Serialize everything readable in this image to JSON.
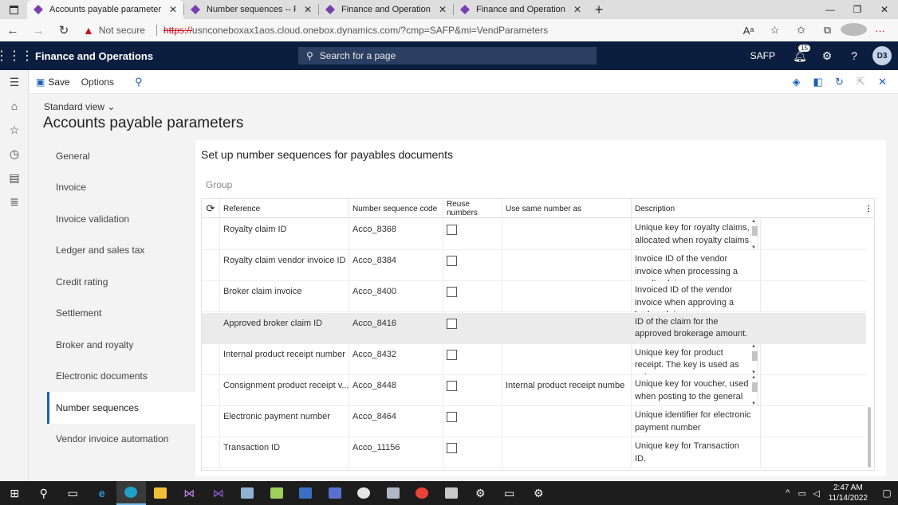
{
  "browser": {
    "tabs": [
      {
        "label": "Accounts payable parameters --",
        "active": true
      },
      {
        "label": "Number sequences -- Finance ar",
        "active": false
      },
      {
        "label": "Finance and Operations",
        "active": false
      },
      {
        "label": "Finance and Operations",
        "active": false
      }
    ],
    "security_label": "Not secure",
    "url_scheme": "https://",
    "url_rest": "usnconeboxax1aos.cloud.onebox.dynamics.com/?cmp=SAFP&mi=VendParameters"
  },
  "app": {
    "title": "Finance and Operations",
    "search_placeholder": "Search for a page",
    "company": "SAFP",
    "notification_count": "15",
    "avatar_initials": "D3"
  },
  "actionpane": {
    "save_label": "Save",
    "options_label": "Options"
  },
  "page": {
    "view_label": "Standard view",
    "title": "Accounts payable parameters",
    "section_title": "Set up number sequences for payables documents",
    "group_label": "Group"
  },
  "vtabs": [
    {
      "label": "General",
      "active": false
    },
    {
      "label": "Invoice",
      "active": false
    },
    {
      "label": "Invoice validation",
      "active": false
    },
    {
      "label": "Ledger and sales tax",
      "active": false
    },
    {
      "label": "Credit rating",
      "active": false
    },
    {
      "label": "Settlement",
      "active": false
    },
    {
      "label": "Broker and royalty",
      "active": false
    },
    {
      "label": "Electronic documents",
      "active": false
    },
    {
      "label": "Number sequences",
      "active": true
    },
    {
      "label": "Vendor invoice automation",
      "active": false
    }
  ],
  "grid": {
    "columns": [
      "Reference",
      "Number sequence code",
      "Reuse numbers",
      "Use same number as",
      "Description"
    ],
    "rows": [
      {
        "reference": "Royalty claim ID",
        "code": "Acco_8368",
        "reuse": false,
        "same_as": "",
        "description": "Unique key for royalty claims, allocated when royalty claims",
        "selected": false,
        "desc_scroll": true
      },
      {
        "reference": "Royalty claim vendor invoice ID",
        "code": "Acco_8384",
        "reuse": false,
        "same_as": "",
        "description": "Invoice ID of the vendor invoice when processing a royalty claim.",
        "selected": false,
        "desc_scroll": false
      },
      {
        "reference": "Broker claim invoice",
        "code": "Acco_8400",
        "reuse": false,
        "same_as": "",
        "description": "Invoiced ID of the vendor invoice when approving a broker claim.",
        "selected": false,
        "desc_scroll": false
      },
      {
        "reference": "Approved broker claim ID",
        "code": "Acco_8416",
        "reuse": false,
        "same_as": "",
        "description": "ID of the claim for the approved brokerage amount.",
        "selected": true,
        "desc_scroll": false
      },
      {
        "reference": "Internal product receipt number",
        "code": "Acco_8432",
        "reuse": false,
        "same_as": "",
        "description": "Unique key for product receipt. The key is used as unique",
        "selected": false,
        "desc_scroll": true
      },
      {
        "reference": "Consignment product receipt v...",
        "code": "Acco_8448",
        "reuse": false,
        "same_as": "Internal product receipt numbe",
        "description": "Unique key for voucher, used when posting to the general",
        "selected": false,
        "desc_scroll": true
      },
      {
        "reference": "Electronic payment number",
        "code": "Acco_8464",
        "reuse": false,
        "same_as": "",
        "description": "Unique identifier for electronic payment number",
        "selected": false,
        "desc_scroll": false
      },
      {
        "reference": "Transaction ID",
        "code": "Acco_11156",
        "reuse": false,
        "same_as": "",
        "description": "Unique key for Transaction ID.",
        "selected": false,
        "desc_scroll": false
      }
    ]
  },
  "taskbar": {
    "time": "2:47 AM",
    "date": "11/14/2022"
  },
  "colors": {
    "appbar": "#0b1e3f",
    "accent": "#1b5fb5",
    "selected_row": "#ebebeb"
  }
}
